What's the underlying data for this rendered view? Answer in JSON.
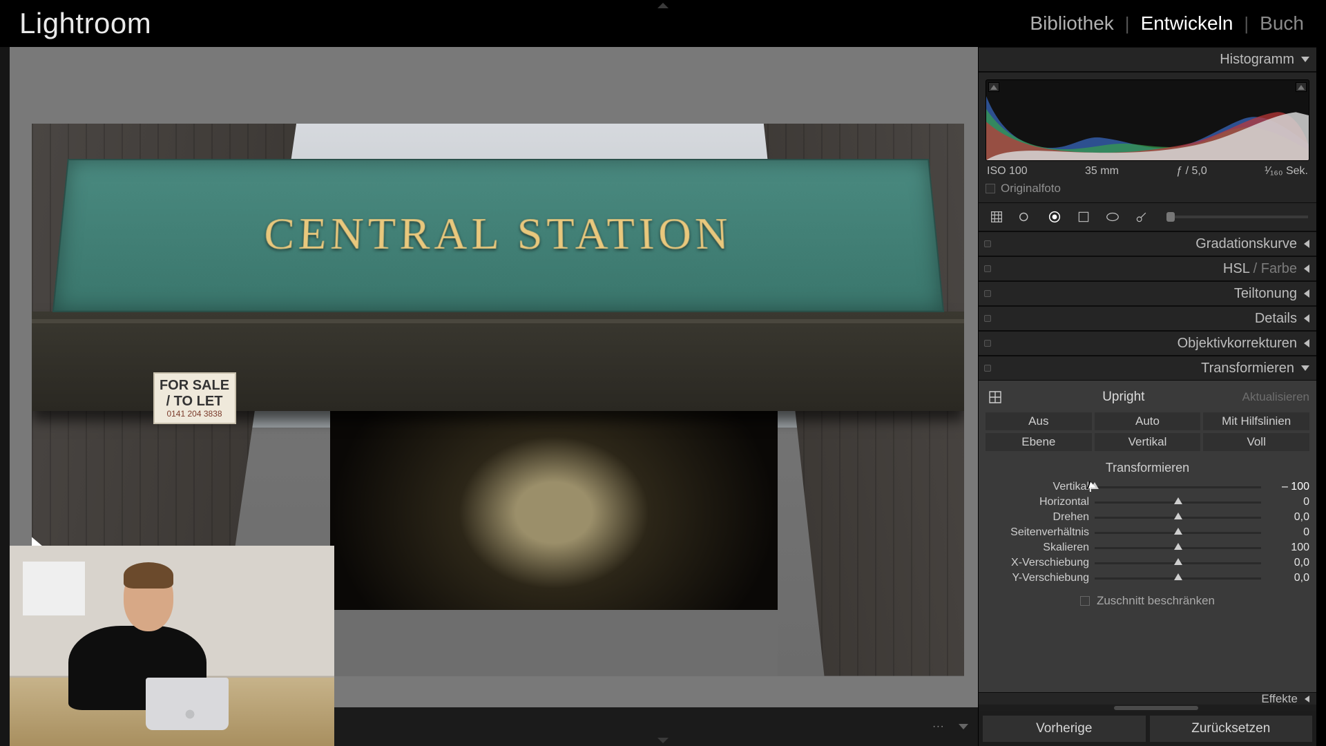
{
  "app": {
    "name": "Lightroom"
  },
  "modules": {
    "library": "Bibliothek",
    "develop": "Entwickeln",
    "book": "Buch",
    "active": "develop"
  },
  "histogram": {
    "title": "Histogramm",
    "iso": "ISO 100",
    "focal": "35 mm",
    "aperture": "ƒ / 5,0",
    "shutter": "¹⁄₁₆₀ Sek.",
    "original_label": "Originalfoto"
  },
  "collapsed_panels": {
    "tone_curve": "Gradationskurve",
    "hsl_prefix": "HSL",
    "hsl_suffix": " / Farbe",
    "split_toning": "Teiltonung",
    "details": "Details",
    "lens_corr": "Objektivkorrekturen"
  },
  "transform": {
    "title": "Transformieren",
    "upright_label": "Upright",
    "update_label": "Aktualisieren",
    "segments": {
      "off": "Aus",
      "auto": "Auto",
      "guided": "Mit Hilfslinien",
      "level": "Ebene",
      "vertical": "Vertikal",
      "full": "Voll"
    },
    "sliders_title": "Transformieren",
    "sliders": {
      "vertical": {
        "label": "Vertikal",
        "value": "– 100",
        "pos": 0
      },
      "horizontal": {
        "label": "Horizontal",
        "value": "0",
        "pos": 50
      },
      "rotate": {
        "label": "Drehen",
        "value": "0,0",
        "pos": 50
      },
      "aspect": {
        "label": "Seitenverhältnis",
        "value": "0",
        "pos": 50
      },
      "scale": {
        "label": "Skalieren",
        "value": "100",
        "pos": 50
      },
      "xoffset": {
        "label": "X-Verschiebung",
        "value": "0,0",
        "pos": 50
      },
      "yoffset": {
        "label": "Y-Verschiebung",
        "value": "0,0",
        "pos": 50
      }
    },
    "constrain_crop": "Zuschnitt beschränken"
  },
  "effects_peek": "Effekte",
  "footer": {
    "previous": "Vorherige",
    "reset": "Zurücksetzen"
  },
  "photo": {
    "fascia_text": "CENTRAL STATION",
    "sign_line1": "FOR SALE",
    "sign_line2": "/ TO LET",
    "sign_phone": "0141 204 3838"
  }
}
